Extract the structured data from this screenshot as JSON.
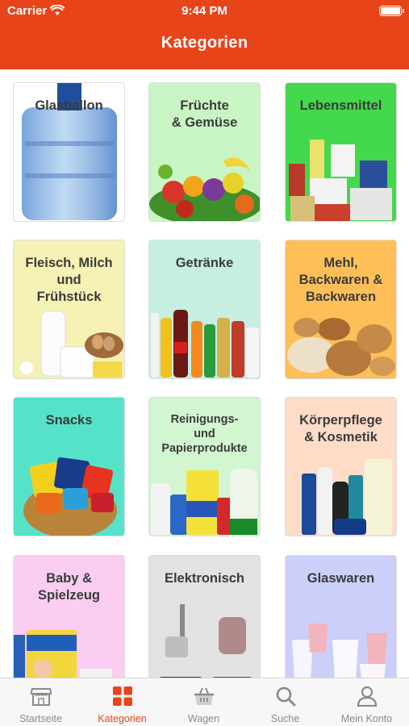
{
  "status_bar": {
    "carrier": "Carrier",
    "time": "9:44 PM"
  },
  "header": {
    "title": "Kategorien"
  },
  "categories": [
    {
      "label": "Glasballon",
      "bg": "#ffffff",
      "icon": "water-jug"
    },
    {
      "label": "Früchte\n& Gemüse",
      "bg": "#c9f5c4",
      "icon": "fruits-vegetables"
    },
    {
      "label": "Lebensmittel",
      "bg": "#44d84c",
      "icon": "groceries"
    },
    {
      "label": "Fleisch, Milch\nund\nFrühstück",
      "bg": "#f6f1b4",
      "icon": "dairy"
    },
    {
      "label": "Getränke",
      "bg": "#c6eee2",
      "icon": "drinks"
    },
    {
      "label": "Mehl,\nBackwaren &\nBackwaren",
      "bg": "#ffbf58",
      "icon": "bread"
    },
    {
      "label": "Snacks",
      "bg": "#56e2c8",
      "icon": "snacks"
    },
    {
      "label": "Reinigungs-\nund\nPapierprodukte",
      "bg": "#d2f6d0",
      "icon": "detergents"
    },
    {
      "label": "Körperpflege\n& Kosmetik",
      "bg": "#ffdcc7",
      "icon": "cosmetics"
    },
    {
      "label": "Baby &\nSpielzeug",
      "bg": "#fbcdf1",
      "icon": "baby"
    },
    {
      "label": "Elektronisch",
      "bg": "#e2e2e2",
      "icon": "appliances"
    },
    {
      "label": "Glaswaren",
      "bg": "#cccffa",
      "icon": "glassware"
    }
  ],
  "tabs": [
    {
      "label": "Startseite",
      "icon": "store-icon",
      "active": false
    },
    {
      "label": "Kategorien",
      "icon": "grid-icon",
      "active": true
    },
    {
      "label": "Wagen",
      "icon": "basket-icon",
      "active": false
    },
    {
      "label": "Suche",
      "icon": "search-icon",
      "active": false
    },
    {
      "label": "Mein Konto",
      "icon": "user-icon",
      "active": false
    }
  ],
  "colors": {
    "accent": "#e8441a",
    "inactive": "#8a8a8a"
  }
}
